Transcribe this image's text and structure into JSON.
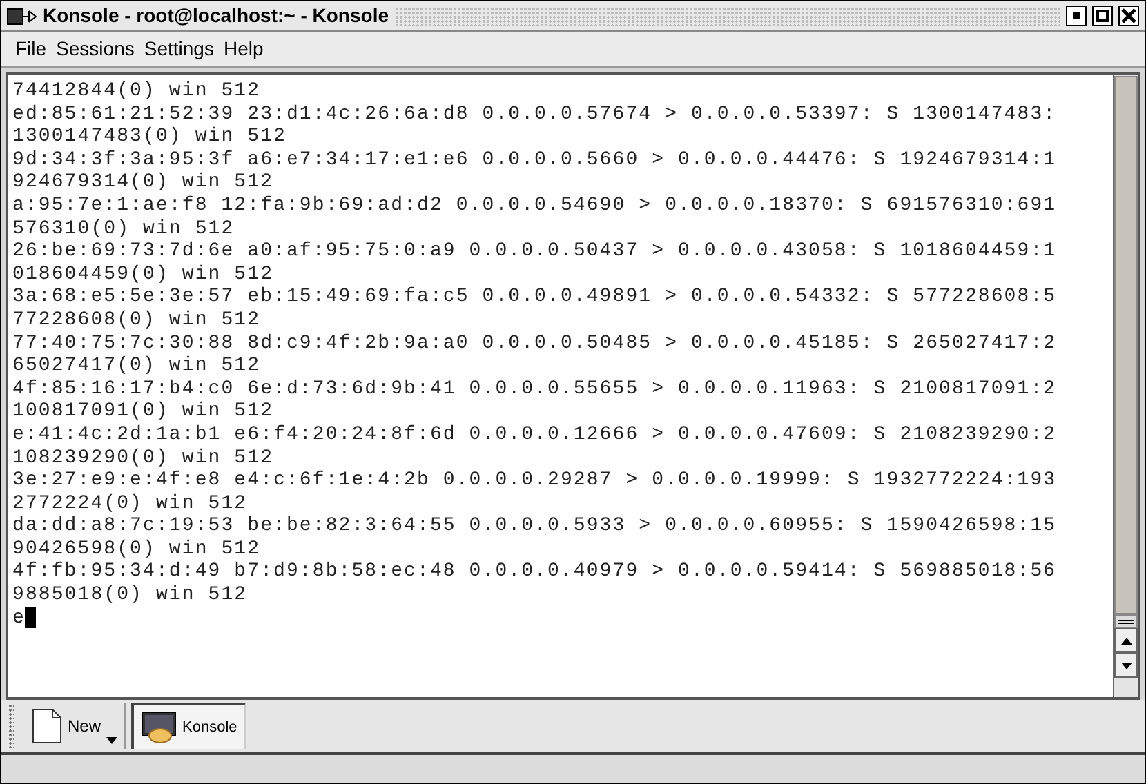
{
  "window": {
    "title": "Konsole - root@localhost:~ - Konsole"
  },
  "menu": [
    "File",
    "Sessions",
    "Settings",
    "Help"
  ],
  "terminal": {
    "lines": [
      "74412844(0) win 512",
      "ed:85:61:21:52:39 23:d1:4c:26:6a:d8 0.0.0.0.57674 > 0.0.0.0.53397: S 1300147483:",
      "1300147483(0) win 512",
      "9d:34:3f:3a:95:3f a6:e7:34:17:e1:e6 0.0.0.0.5660 > 0.0.0.0.44476: S 1924679314:1",
      "924679314(0) win 512",
      "a:95:7e:1:ae:f8 12:fa:9b:69:ad:d2 0.0.0.0.54690 > 0.0.0.0.18370: S 691576310:691",
      "576310(0) win 512",
      "26:be:69:73:7d:6e a0:af:95:75:0:a9 0.0.0.0.50437 > 0.0.0.0.43058: S 1018604459:1",
      "018604459(0) win 512",
      "3a:68:e5:5e:3e:57 eb:15:49:69:fa:c5 0.0.0.0.49891 > 0.0.0.0.54332: S 577228608:5",
      "77228608(0) win 512",
      "77:40:75:7c:30:88 8d:c9:4f:2b:9a:a0 0.0.0.0.50485 > 0.0.0.0.45185: S 265027417:2",
      "65027417(0) win 512",
      "4f:85:16:17:b4:c0 6e:d:73:6d:9b:41 0.0.0.0.55655 > 0.0.0.0.11963: S 2100817091:2",
      "100817091(0) win 512",
      "e:41:4c:2d:1a:b1 e6:f4:20:24:8f:6d 0.0.0.0.12666 > 0.0.0.0.47609: S 2108239290:2",
      "108239290(0) win 512",
      "3e:27:e9:e:4f:e8 e4:c:6f:1e:4:2b 0.0.0.0.29287 > 0.0.0.0.19999: S 1932772224:193",
      "2772224(0) win 512",
      "da:dd:a8:7c:19:53 be:be:82:3:64:55 0.0.0.0.5933 > 0.0.0.0.60955: S 1590426598:15",
      "90426598(0) win 512",
      "4f:fb:95:34:d:49 b7:d9:8b:58:ec:48 0.0.0.0.40979 > 0.0.0.0.59414: S 569885018:56",
      "9885018(0) win 512"
    ],
    "prompt": "e"
  },
  "tabs": [
    {
      "label": "New",
      "selected": false
    },
    {
      "label": "Konsole",
      "selected": true
    }
  ]
}
